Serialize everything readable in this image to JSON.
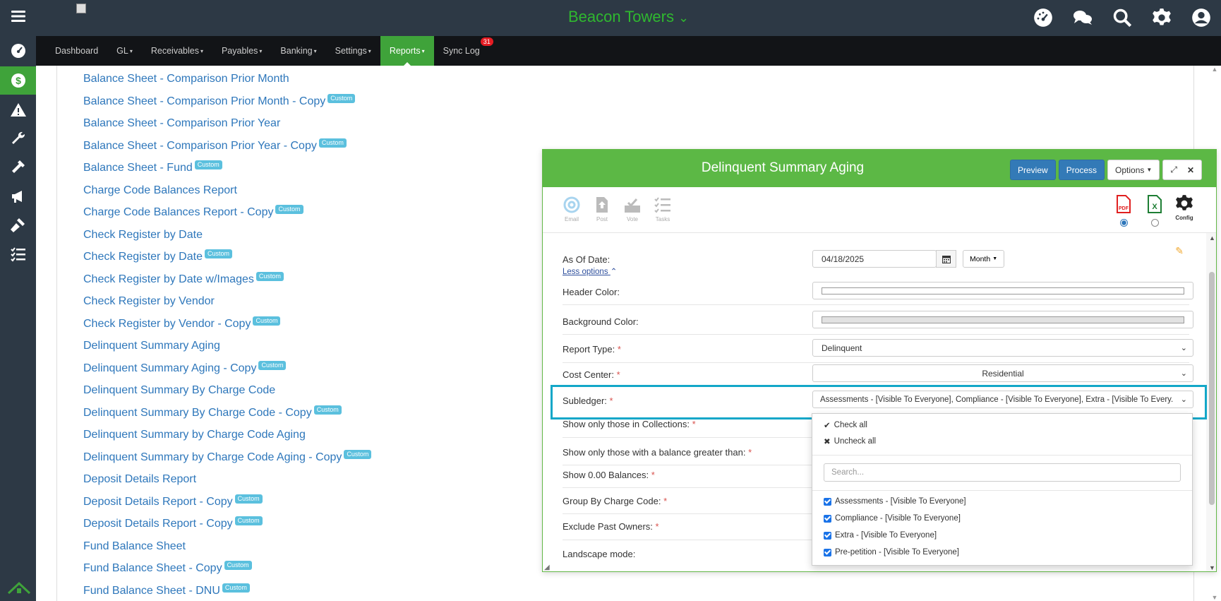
{
  "header": {
    "brand": "Beacon Towers",
    "icons": [
      "dashboard-icon",
      "chat-icon",
      "search-icon",
      "gear-icon",
      "user-icon"
    ]
  },
  "rail": {
    "icons": [
      "menu-icon",
      "dashboard-icon",
      "dollar-icon",
      "warning-icon",
      "wrench-icon",
      "hammer-icon",
      "megaphone-icon",
      "gavel-icon",
      "tasks-icon",
      "home-logo-icon"
    ]
  },
  "nav": {
    "items": [
      {
        "label": "Dashboard",
        "caret": ""
      },
      {
        "label": "GL",
        "caret": "▾"
      },
      {
        "label": "Receivables",
        "caret": "▾"
      },
      {
        "label": "Payables",
        "caret": "▾"
      },
      {
        "label": "Banking",
        "caret": "▾"
      },
      {
        "label": "Settings",
        "caret": "▾"
      },
      {
        "label": "Reports",
        "caret": "▾"
      },
      {
        "label": "Sync Log",
        "caret": ""
      }
    ],
    "sync_badge": "31"
  },
  "reports": [
    {
      "name": "Balance Sheet - Comparison Prior Month",
      "badge": ""
    },
    {
      "name": "Balance Sheet - Comparison Prior Month - Copy",
      "badge": "Custom"
    },
    {
      "name": "Balance Sheet - Comparison Prior Year",
      "badge": ""
    },
    {
      "name": "Balance Sheet - Comparison Prior Year - Copy",
      "badge": "Custom"
    },
    {
      "name": "Balance Sheet - Fund",
      "badge": "Custom"
    },
    {
      "name": "Charge Code Balances Report",
      "badge": ""
    },
    {
      "name": "Charge Code Balances Report - Copy",
      "badge": "Custom"
    },
    {
      "name": "Check Register by Date",
      "badge": ""
    },
    {
      "name": "Check Register by Date",
      "badge": "Custom"
    },
    {
      "name": "Check Register by Date w/Images",
      "badge": "Custom"
    },
    {
      "name": "Check Register by Vendor",
      "badge": ""
    },
    {
      "name": "Check Register by Vendor - Copy",
      "badge": "Custom"
    },
    {
      "name": "Delinquent Summary Aging",
      "badge": ""
    },
    {
      "name": "Delinquent Summary Aging - Copy",
      "badge": "Custom"
    },
    {
      "name": "Delinquent Summary By Charge Code",
      "badge": ""
    },
    {
      "name": "Delinquent Summary By Charge Code - Copy",
      "badge": "Custom"
    },
    {
      "name": "Delinquent Summary by Charge Code Aging",
      "badge": ""
    },
    {
      "name": "Delinquent Summary by Charge Code Aging - Copy",
      "badge": "Custom"
    },
    {
      "name": "Deposit Details Report",
      "badge": ""
    },
    {
      "name": "Deposit Details Report - Copy",
      "badge": "Custom"
    },
    {
      "name": "Deposit Details Report - Copy",
      "badge": "Custom"
    },
    {
      "name": "Fund Balance Sheet",
      "badge": ""
    },
    {
      "name": "Fund Balance Sheet - Copy",
      "badge": "Custom"
    },
    {
      "name": "Fund Balance Sheet - DNU",
      "badge": "Custom"
    }
  ],
  "modal": {
    "title": "Delinquent Summary Aging",
    "preview": "Preview",
    "process": "Process",
    "options": "Options",
    "tools": [
      "Email",
      "Post",
      "Vote",
      "Tasks"
    ],
    "config": "Config",
    "less_options": "Less options",
    "fields": {
      "as_of_date": {
        "label": "As Of Date:",
        "value": "04/18/2025",
        "period": "Month"
      },
      "header_color": {
        "label": "Header Color:"
      },
      "background_color": {
        "label": "Background Color:"
      },
      "report_type": {
        "label": "Report Type:",
        "value": "Delinquent"
      },
      "cost_center": {
        "label": "Cost Center:",
        "value": "Residential"
      },
      "subledger": {
        "label": "Subledger:",
        "value": "Assessments - [Visible To Everyone], Compliance - [Visible To Everyone], Extra - [Visible To Every..."
      },
      "collections": {
        "label": "Show only those in Collections:"
      },
      "balance_greater": {
        "label": "Show only those with a balance greater than:"
      },
      "zero_balances": {
        "label": "Show 0.00 Balances:"
      },
      "group_by_cc": {
        "label": "Group By Charge Code:"
      },
      "exclude_past": {
        "label": "Exclude Past Owners:"
      },
      "landscape": {
        "label": "Landscape mode:"
      }
    },
    "required_mark": "*"
  },
  "dropdown": {
    "check_all": "Check all",
    "uncheck_all": "Uncheck all",
    "search_placeholder": "Search...",
    "options": [
      {
        "label": "Assessments - [Visible To Everyone]",
        "checked": true
      },
      {
        "label": "Compliance - [Visible To Everyone]",
        "checked": true
      },
      {
        "label": "Extra - [Visible To Everyone]",
        "checked": true
      },
      {
        "label": "Pre-petition - [Visible To Everyone]",
        "checked": true
      }
    ]
  },
  "colors": {
    "accent_green": "#5cb845",
    "header_bg": "#2d3945",
    "link_blue": "#2e77bb",
    "highlight": "#13a7c8"
  }
}
